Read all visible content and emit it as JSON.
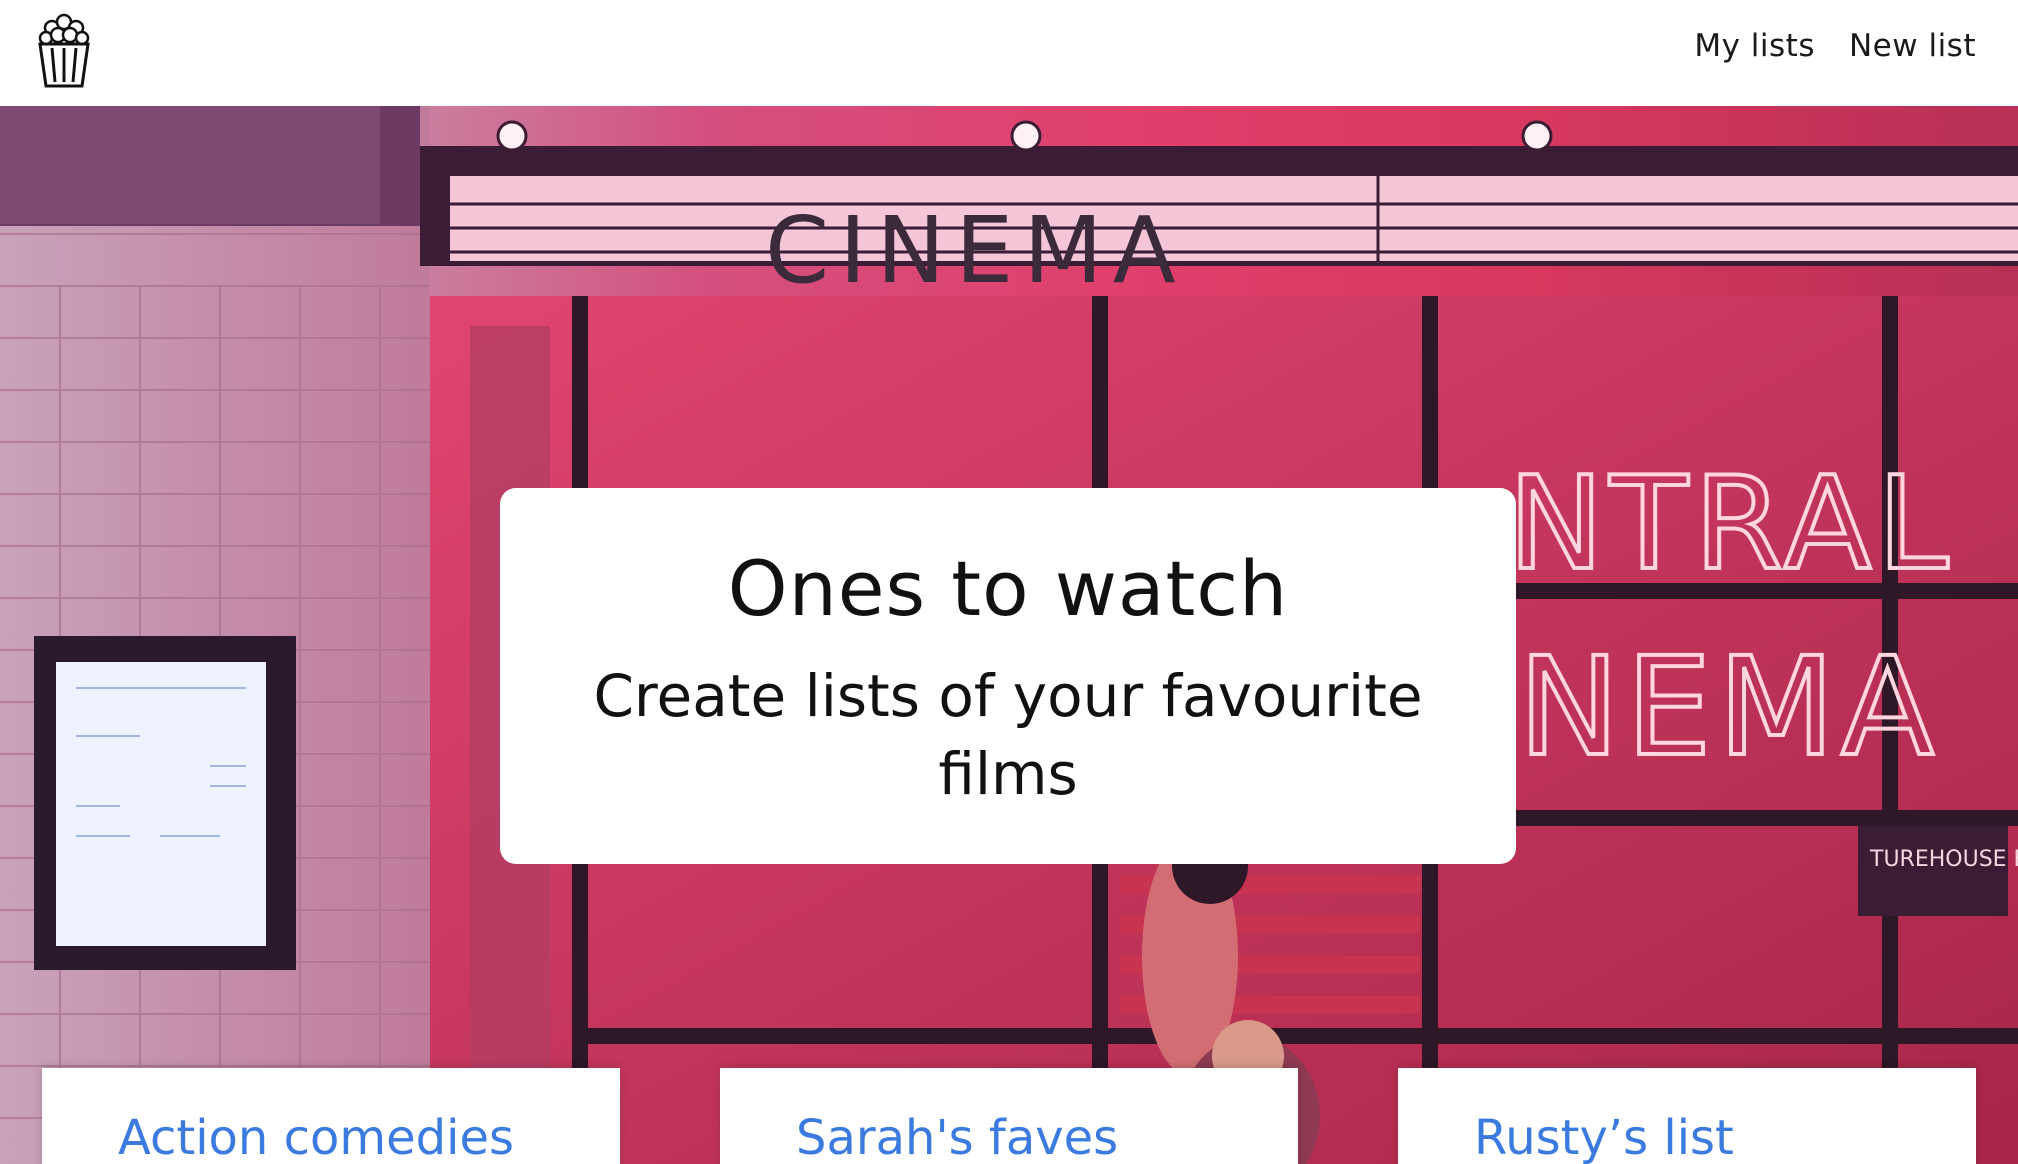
{
  "header": {
    "logo_icon": "popcorn-icon",
    "nav": [
      {
        "label": "My lists"
      },
      {
        "label": "New list"
      }
    ]
  },
  "hero": {
    "sign_text": "CINEMA",
    "neon_line1": "NTRAL",
    "neon_line2": "NEMA",
    "small_sign": "TUREHOUSE ENTRAL"
  },
  "intro": {
    "title": "Ones to watch",
    "subtitle": "Create lists of your favourite films"
  },
  "cards": [
    {
      "title": "Action comedies"
    },
    {
      "title": "Sarah's faves"
    },
    {
      "title": "Rusty’s list"
    }
  ],
  "colors": {
    "link": "#3b7be0",
    "neon_pink": "#ff6b8e"
  }
}
